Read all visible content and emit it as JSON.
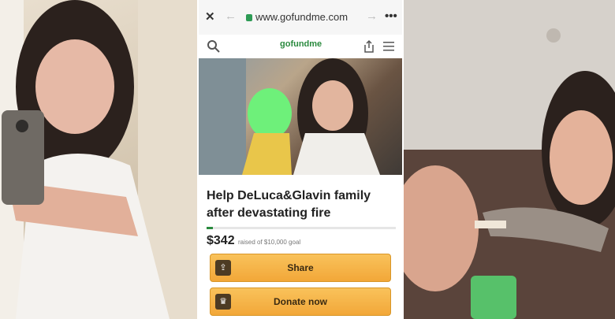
{
  "browser": {
    "close_icon": "close-icon",
    "back_icon": "back-arrow-icon",
    "forward_icon": "forward-arrow-icon",
    "more_icon": "more-icon",
    "url": "www.gofundme.com"
  },
  "site": {
    "logo": "gofundme",
    "search_icon": "search-icon",
    "share_icon": "share-icon",
    "menu_icon": "hamburger-menu-icon"
  },
  "campaign": {
    "title": "Help DeLuca&Glavin family after devastating fire",
    "raised": "$342",
    "goal_text": "raised of $10,000 goal",
    "progress_fraction": 0.034,
    "share_label": "Share",
    "donate_label": "Donate now"
  }
}
